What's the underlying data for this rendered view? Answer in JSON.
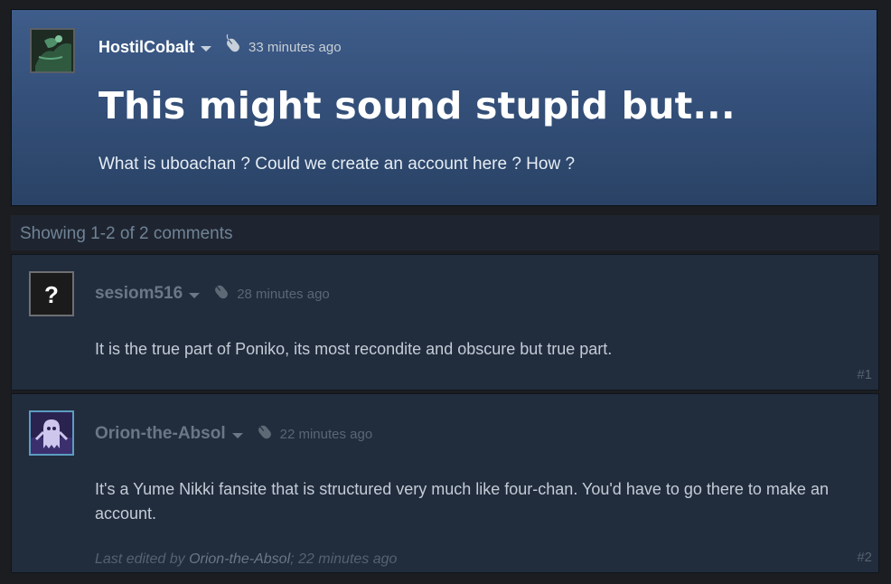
{
  "topic": {
    "author": "HostilCobalt",
    "timestamp": "33 minutes ago",
    "title": "This might sound stupid but...",
    "body": "What is uboachan ? Could we create an account here ? How ?"
  },
  "comments_header": {
    "count_text": "Showing 1-2 of 2 comments"
  },
  "comments": [
    {
      "author": "sesiom516",
      "timestamp": "28 minutes ago",
      "body": "It is the true part of Poniko, its most recondite and obscure but true part.",
      "number": "#1",
      "avatar": "question-mark"
    },
    {
      "author": "Orion-the-Absol",
      "timestamp": "22 minutes ago",
      "body": "It's a Yume Nikki fansite that is structured very much like four-chan. You'd have to go there to make an account.",
      "number": "#2",
      "edited_prefix": "Last edited by ",
      "edited_by": "Orion-the-Absol",
      "edited_suffix": "; 22 minutes ago",
      "avatar": "ghost"
    }
  ],
  "colors": {
    "page_bg": "#1b1d21",
    "topic_bg": "#3a5682",
    "comment_bg": "#212c3d",
    "muted_text": "#6b7785",
    "count_text": "#6f8396"
  },
  "icons": {
    "author_menu": "chevron-down-icon",
    "timestamp": "mouse-icon"
  }
}
